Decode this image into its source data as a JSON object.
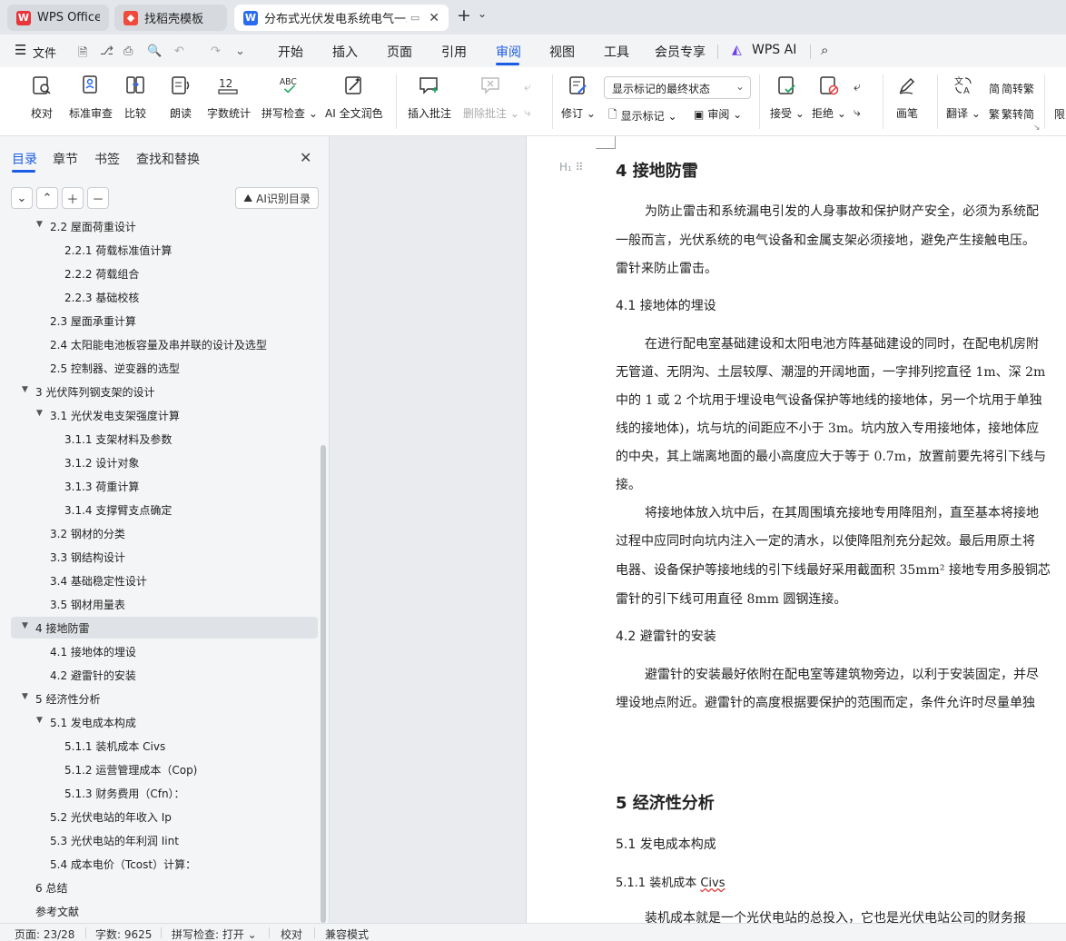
{
  "titlebar": {
    "tabs": [
      {
        "label": "WPS Office",
        "icon": "wps-logo-icon"
      },
      {
        "label": "找稻壳模板",
        "icon": "docer-icon"
      },
      {
        "label": "分布式光伏发电系统电气一次",
        "icon": "writer-doc-icon"
      }
    ],
    "new_tab": "+",
    "tab_list": "⌄"
  },
  "menubar": {
    "file": "文件",
    "items": [
      "开始",
      "插入",
      "页面",
      "引用",
      "审阅",
      "视图",
      "工具",
      "会员专享"
    ],
    "active": "审阅",
    "wps_ai": "WPS AI"
  },
  "ribbon": {
    "proofread": "校对",
    "standard_review": "标准审查",
    "compare": "比较",
    "read_aloud": "朗读",
    "word_count": "字数统计",
    "spell_check": "拼写检查",
    "ai_proofread": "AI 全文润色",
    "insert_comment": "插入批注",
    "delete_comment": "删除批注",
    "track_changes": "修订",
    "markup_mode": "显示标记的最终状态",
    "show_markup": "显示标记",
    "review_pane": "审阅",
    "accept": "接受",
    "reject": "拒绝",
    "pen": "画笔",
    "translate": "翻译",
    "to_traditional": "简转繁",
    "to_simplified": "繁转简",
    "limit": "限"
  },
  "sidebar": {
    "tabs": [
      "目录",
      "章节",
      "书签",
      "查找和替换"
    ],
    "ai_toc": "AI识别目录",
    "toc": [
      {
        "label": "2.2 屋面荷重设计",
        "level": 2,
        "caret": "▼"
      },
      {
        "label": "2.2.1  荷载标准值计算",
        "level": 3,
        "caret": ""
      },
      {
        "label": "2.2.2  荷载组合",
        "level": 3,
        "caret": ""
      },
      {
        "label": "2.2.3  基础校核",
        "level": 3,
        "caret": ""
      },
      {
        "label": "2.3  屋面承重计算",
        "level": 2,
        "caret": ""
      },
      {
        "label": "2.4  太阳能电池板容量及串并联的设计及选型",
        "level": 2,
        "caret": ""
      },
      {
        "label": "2.5  控制器、逆变器的选型",
        "level": 2,
        "caret": ""
      },
      {
        "label": "3  光伏阵列钢支架的设计",
        "level": 1,
        "caret": "▼"
      },
      {
        "label": "3.1 光伏发电支架强度计算",
        "level": 2,
        "caret": "▼"
      },
      {
        "label": "3.1.1  支架材料及参数",
        "level": 3,
        "caret": ""
      },
      {
        "label": "3.1.2  设计对象",
        "level": 3,
        "caret": ""
      },
      {
        "label": "3.1.3  荷重计算",
        "level": 3,
        "caret": ""
      },
      {
        "label": "3.1.4  支撑臂支点确定",
        "level": 3,
        "caret": ""
      },
      {
        "label": "3.2  钢材的分类",
        "level": 2,
        "caret": ""
      },
      {
        "label": "3.3  钢结构设计",
        "level": 2,
        "caret": ""
      },
      {
        "label": "3.4  基础稳定性设计",
        "level": 2,
        "caret": ""
      },
      {
        "label": "3.5  钢材用量表",
        "level": 2,
        "caret": ""
      },
      {
        "label": "4  接地防雷",
        "level": 1,
        "caret": "▼",
        "selected": true
      },
      {
        "label": "4.1  接地体的埋设",
        "level": 2,
        "caret": ""
      },
      {
        "label": "4.2  避雷针的安装",
        "level": 2,
        "caret": ""
      },
      {
        "label": "5  经济性分析",
        "level": 1,
        "caret": "▼"
      },
      {
        "label": "5.1 发电成本构成",
        "level": 2,
        "caret": "▼"
      },
      {
        "label": "5.1.1 装机成本 Civs",
        "level": 3,
        "caret": ""
      },
      {
        "label": "5.1.2  运营管理成本（Cop)",
        "level": 3,
        "caret": ""
      },
      {
        "label": "5.1.3  财务费用（Cfn）：",
        "level": 3,
        "caret": ""
      },
      {
        "label": "5.2  光伏电站的年收入 Ip",
        "level": 2,
        "caret": ""
      },
      {
        "label": "5.3  光伏电站的年利润 Iint",
        "level": 2,
        "caret": ""
      },
      {
        "label": "5.4  成本电价（Tcost）计算：",
        "level": 2,
        "caret": ""
      },
      {
        "label": "6  总结",
        "level": 1,
        "caret": ""
      },
      {
        "label": "参考文献",
        "level": 1,
        "caret": ""
      }
    ]
  },
  "document": {
    "heading_marker": "H₁",
    "h4": "4  接地防雷",
    "p4_lines": [
      "为防止雷击和系统漏电引发的人身事故和保护财产安全，必须为系统配",
      "一般而言，光伏系统的电气设备和金属支架必须接地，避免产生接触电压。",
      "雷针来防止雷击。"
    ],
    "h41": "4.1  接地体的埋设",
    "p41_lines": [
      "在进行配电室基础建设和太阳电池方阵基础建设的同时，在配电机房附",
      "无管道、无阴沟、土层较厚、潮湿的开阔地面，一字排列挖直径 1m、深 2m",
      "中的 1 或 2 个坑用于埋设电气设备保护等地线的接地体，另一个坑用于单独",
      "线的接地体)，坑与坑的间距应不小于 3m。坑内放入专用接地体，接地体应",
      "的中央，其上端离地面的最小高度应大于等于 0.7m，放置前要先将引下线与",
      "接。",
      "将接地体放入坑中后，在其周围填充接地专用降阻剂，直至基本将接地",
      "过程中应同时向坑内注入一定的清水，以使降阻剂充分起效。最后用原土将",
      "电器、设备保护等接地线的引下线最好采用截面积 35mm² 接地专用多股铜芯",
      "雷针的引下线可用直径 8mm 圆钢连接。"
    ],
    "h42": "4.2  避雷针的安装",
    "p42_lines": [
      "避雷针的安装最好依附在配电室等建筑物旁边，以利于安装固定，并尽",
      "埋设地点附近。避雷针的高度根据要保护的范围而定，条件允许时尽量单独"
    ],
    "h5": "5  经济性分析",
    "h51": "5.1 发电成本构成",
    "h511_prefix": "5.1.1 装机成本 ",
    "h511_term": "Civs",
    "p511": "装机成本就是一个光伏电站的总投入，它也是光伏电站公司的财务报"
  },
  "statusbar": {
    "page": "页面: 23/28",
    "words": "字数: 9625",
    "spell": "拼写检查: 打开",
    "proof": "校对",
    "compat": "兼容模式"
  }
}
